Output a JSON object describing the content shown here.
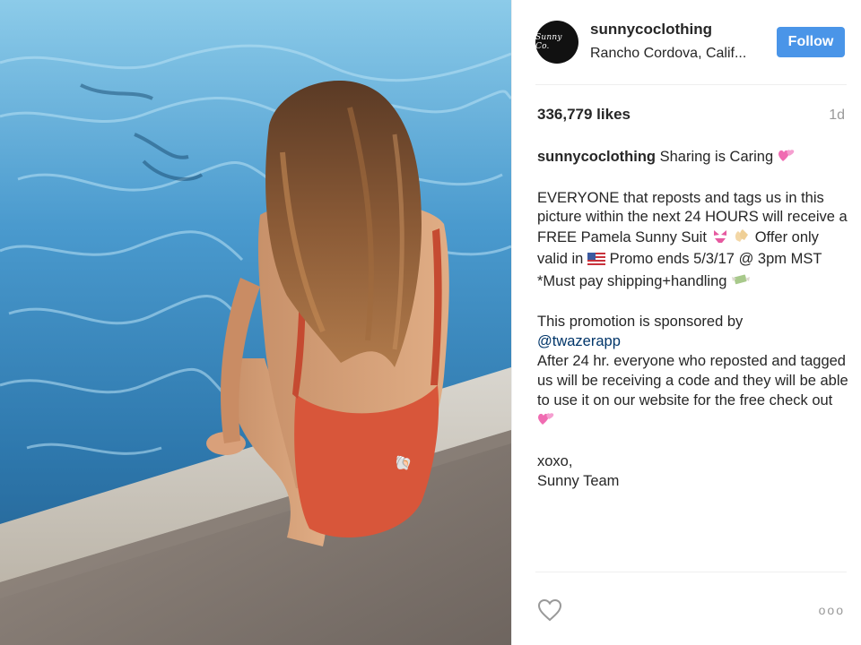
{
  "photo": {
    "alt": "Woman in red swimsuit sitting at pool edge",
    "swimsuit_color": "#d8563a",
    "water_color": "#2f7fb8"
  },
  "header": {
    "avatar_text": "Sunny Co.",
    "username": "sunnycoclothing",
    "location": "Rancho Cordova, Calif...",
    "follow_label": "Follow",
    "follow_color": "#4a95e8"
  },
  "stats": {
    "likes": "336,779 likes",
    "time_ago": "1d"
  },
  "caption": {
    "author": "sunnycoclothing",
    "headline": "Sharing is Caring",
    "para1_part1": "EVERYONE that reposts and tags us in this picture within the next 24 HOURS will receive a FREE Pamela Sunny Suit",
    "para1_part2": "Offer only valid in",
    "para1_part3": "Promo ends 5/3/17 @ 3pm MST *Must pay shipping+handling",
    "para2_intro": "This promotion is sponsored by",
    "mention": "@twazerapp",
    "para2_rest": "After 24 hr. everyone who reposted and tagged us will be receiving a code and they will be able to use it on our website for the free check out",
    "signoff_1": "xoxo,",
    "signoff_2": "Sunny Team"
  },
  "icons": {
    "heart": "heart-icon",
    "more": "more-options-icon",
    "emoji_hearts": "two-hearts-icon",
    "emoji_bikini": "bikini-icon",
    "emoji_clap": "clapping-hands-icon",
    "emoji_flag": "us-flag-icon",
    "emoji_money": "money-wings-icon"
  },
  "actions": {
    "more_label": "ooo"
  }
}
